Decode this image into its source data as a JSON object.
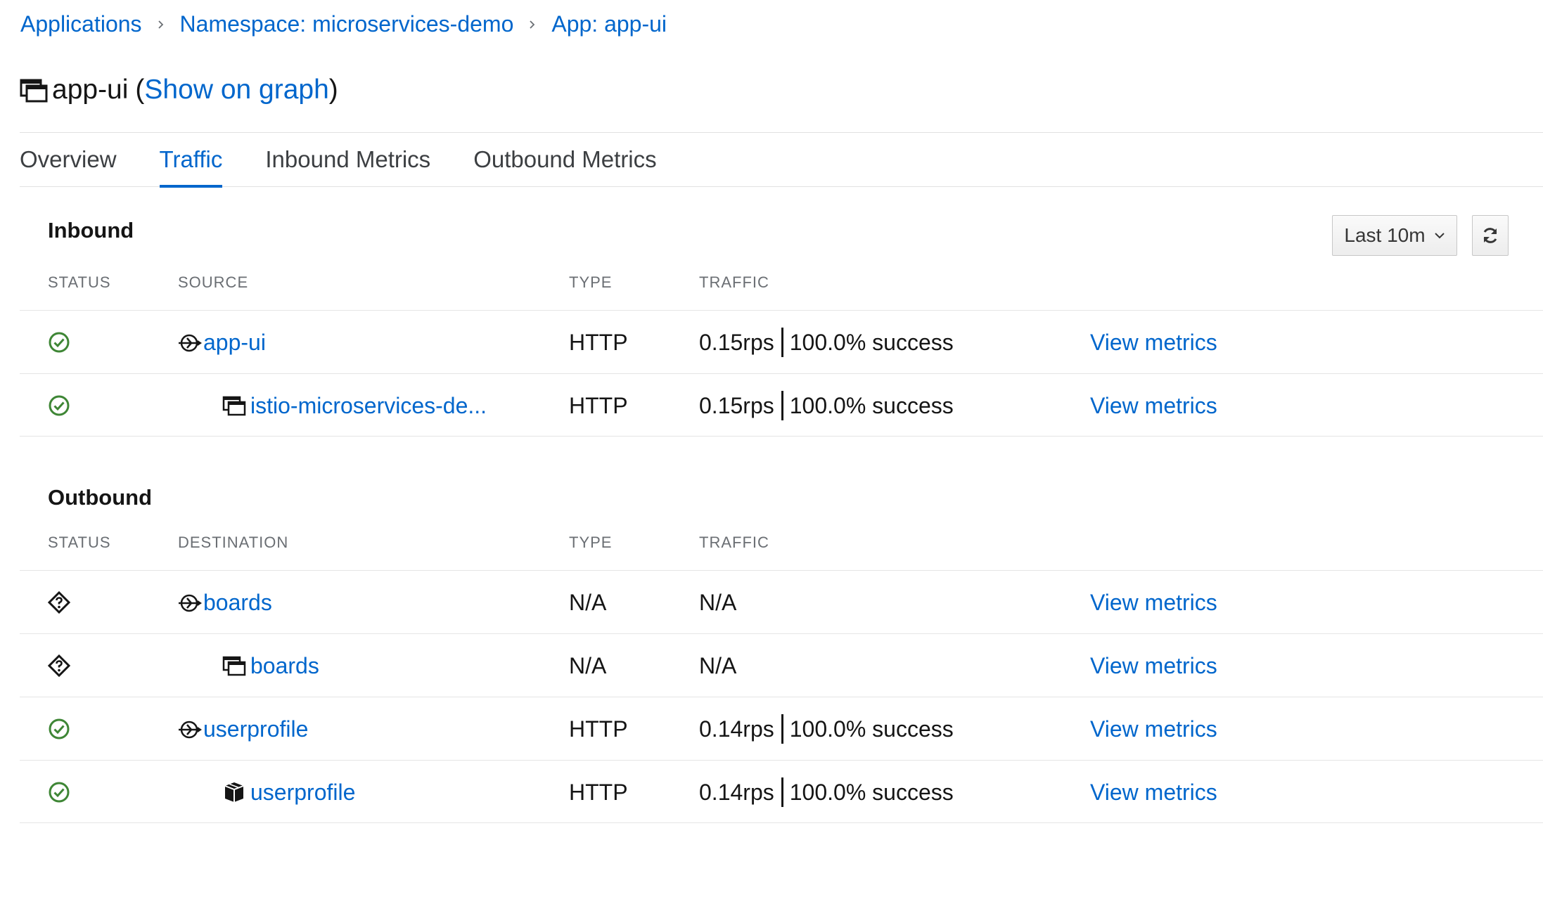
{
  "breadcrumb": {
    "items": [
      "Applications",
      "Namespace: microservices-demo",
      "App: app-ui"
    ]
  },
  "title": {
    "name": "app-ui",
    "open_paren": "(",
    "graph_link": "Show on graph",
    "close_paren": ")"
  },
  "tabs": [
    "Overview",
    "Traffic",
    "Inbound Metrics",
    "Outbound Metrics"
  ],
  "active_tab": "Traffic",
  "toolbar": {
    "time_range": "Last 10m",
    "refresh_icon": "refresh-icon"
  },
  "inbound": {
    "title": "Inbound",
    "columns": [
      "STATUS",
      "SOURCE",
      "TYPE",
      "TRAFFIC"
    ],
    "rows": [
      {
        "status": "healthy",
        "icon": "service-icon",
        "name": "app-ui",
        "type": "HTTP",
        "rps": "0.15rps",
        "success": "100.0% success",
        "action": "View metrics"
      },
      {
        "status": "healthy",
        "icon": "app-icon",
        "name": "istio-microservices-de...",
        "type": "HTTP",
        "rps": "0.15rps",
        "success": "100.0% success",
        "action": "View metrics"
      }
    ]
  },
  "outbound": {
    "title": "Outbound",
    "columns": [
      "STATUS",
      "DESTINATION",
      "TYPE",
      "TRAFFIC"
    ],
    "rows": [
      {
        "status": "unknown",
        "icon": "service-icon",
        "name": "boards",
        "type": "N/A",
        "traffic": "N/A",
        "action": "View metrics"
      },
      {
        "status": "unknown",
        "icon": "app-icon",
        "name": "boards",
        "type": "N/A",
        "traffic": "N/A",
        "action": "View metrics"
      },
      {
        "status": "healthy",
        "icon": "service-icon",
        "name": "userprofile",
        "type": "HTTP",
        "rps": "0.14rps",
        "success": "100.0% success",
        "action": "View metrics"
      },
      {
        "status": "healthy",
        "icon": "workload-icon",
        "name": "userprofile",
        "type": "HTTP",
        "rps": "0.14rps",
        "success": "100.0% success",
        "action": "View metrics"
      }
    ]
  },
  "colors": {
    "link": "#0066cc",
    "healthy": "#3e8635"
  }
}
